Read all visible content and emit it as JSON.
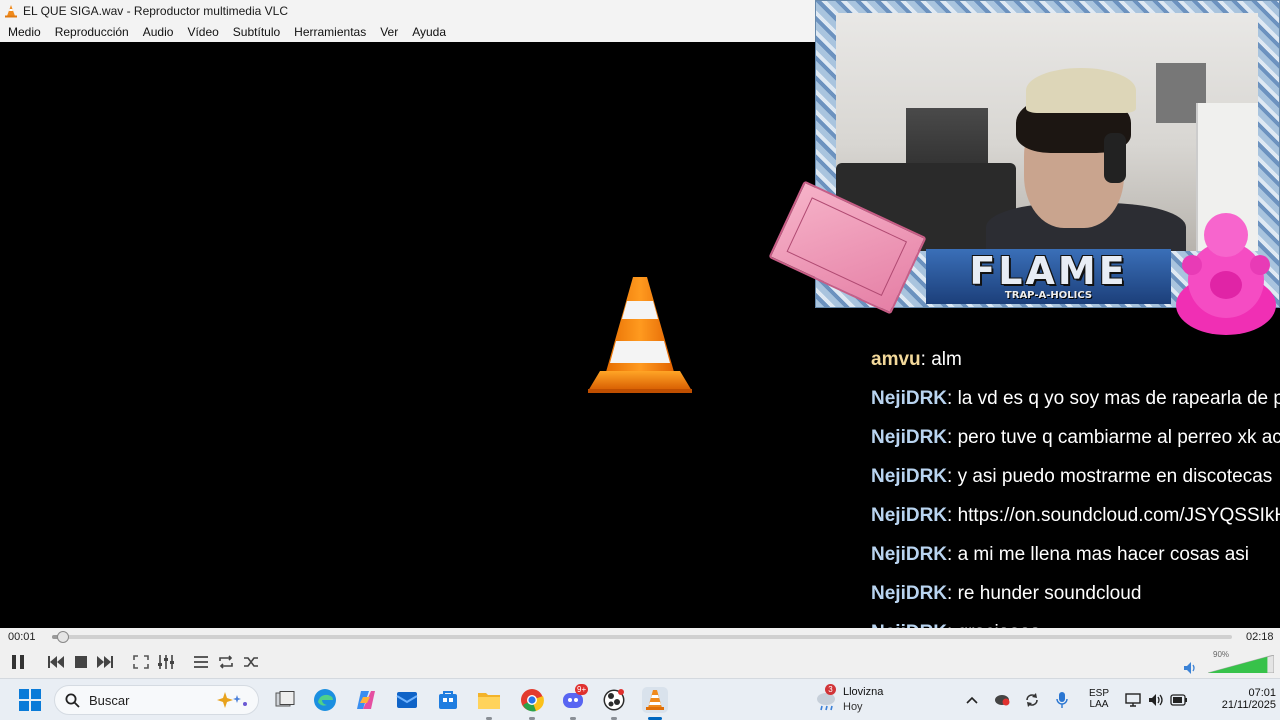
{
  "window": {
    "title": "EL QUE SIGA.wav - Reproductor multimedia VLC"
  },
  "menu": [
    "Medio",
    "Reproducción",
    "Audio",
    "Vídeo",
    "Subtítulo",
    "Herramientas",
    "Ver",
    "Ayuda"
  ],
  "overlay": {
    "banner_title": "FLAME",
    "banner_subtitle": "TRAP-A-HOLICS"
  },
  "chat": [
    {
      "user": "amvu",
      "user_color": "#f2d89a",
      "message": "alm"
    },
    {
      "user": "NejiDRK",
      "user_color": "#b9d4f0",
      "message": "la vd es q yo soy mas de rapearla de p"
    },
    {
      "user": "NejiDRK",
      "user_color": "#b9d4f0",
      "message": "pero tuve q cambiarme al perreo xk ac"
    },
    {
      "user": "NejiDRK",
      "user_color": "#b9d4f0",
      "message": "y asi puedo mostrarme en discotecas"
    },
    {
      "user": "NejiDRK",
      "user_color": "#b9d4f0",
      "message": "https://on.soundcloud.com/JSYQSSIkH"
    },
    {
      "user": "NejiDRK",
      "user_color": "#b9d4f0",
      "message": "a mi me llena mas hacer cosas asi"
    },
    {
      "user": "NejiDRK",
      "user_color": "#b9d4f0",
      "message": "re hunder soundcloud"
    },
    {
      "user": "NejiDRK",
      "user_color": "#b9d4f0",
      "message": "graciaaas"
    }
  ],
  "player": {
    "elapsed": "00:01",
    "total": "02:18",
    "progress": 0.006,
    "volume_label": "90%",
    "volume_level": 0.9
  },
  "controls": {
    "icons": [
      "pause-icon",
      "previous-icon",
      "stop-icon",
      "next-icon",
      "fullscreen-icon",
      "extended-settings-icon",
      "playlist-icon",
      "loop-icon",
      "shuffle-icon",
      "volume-icon"
    ]
  },
  "taskbar": {
    "search_label": "Buscar",
    "weather_condition": "Llovizna",
    "weather_day": "Hoy",
    "weather_badge": "3",
    "language_top": "ESP",
    "language_bottom": "LAA",
    "time": "07:01",
    "date": "21/11/2025",
    "discord_badge": "9+",
    "accent": "#0067c0"
  }
}
